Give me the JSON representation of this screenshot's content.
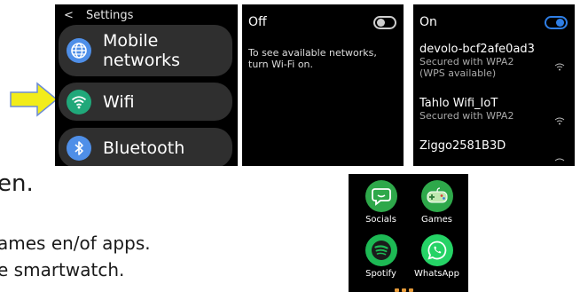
{
  "document": {
    "line1": "en.",
    "line2": "ames en/of apps.",
    "line3": "e smartwatch."
  },
  "settings_screen": {
    "back_glyph": "<",
    "title": "Settings",
    "items": [
      {
        "label": "Mobile networks",
        "icon": "globe-icon"
      },
      {
        "label": "Wifi",
        "icon": "wifi-icon"
      },
      {
        "label": "Bluetooth",
        "icon": "bluetooth-icon"
      }
    ]
  },
  "wifi_off_screen": {
    "toggle_label": "Off",
    "toggle_state": "off",
    "message": "To see available networks, turn Wi-Fi on."
  },
  "wifi_on_screen": {
    "toggle_label": "On",
    "toggle_state": "on",
    "networks": [
      {
        "name": "devolo-bcf2afe0ad3",
        "status": "Secured with WPA2 (WPS available)"
      },
      {
        "name": "Tahlo Wifi_IoT",
        "status": "Secured with WPA2"
      },
      {
        "name": "Ziggo2581B3D",
        "status": ""
      }
    ]
  },
  "apps_screen": {
    "apps": [
      {
        "label": "Socials",
        "icon": "chat-icon",
        "color": "#2ea84a"
      },
      {
        "label": "Games",
        "icon": "gamepad-icon",
        "color": "#2ea84a"
      },
      {
        "label": "Spotify",
        "icon": "spotify-icon",
        "color": "#1db954"
      },
      {
        "label": "WhatsApp",
        "icon": "whatsapp-icon",
        "color": "#25d366"
      }
    ]
  },
  "colors": {
    "accent_blue": "#2f7fe6",
    "arrow_yellow": "#f2ec1a"
  }
}
